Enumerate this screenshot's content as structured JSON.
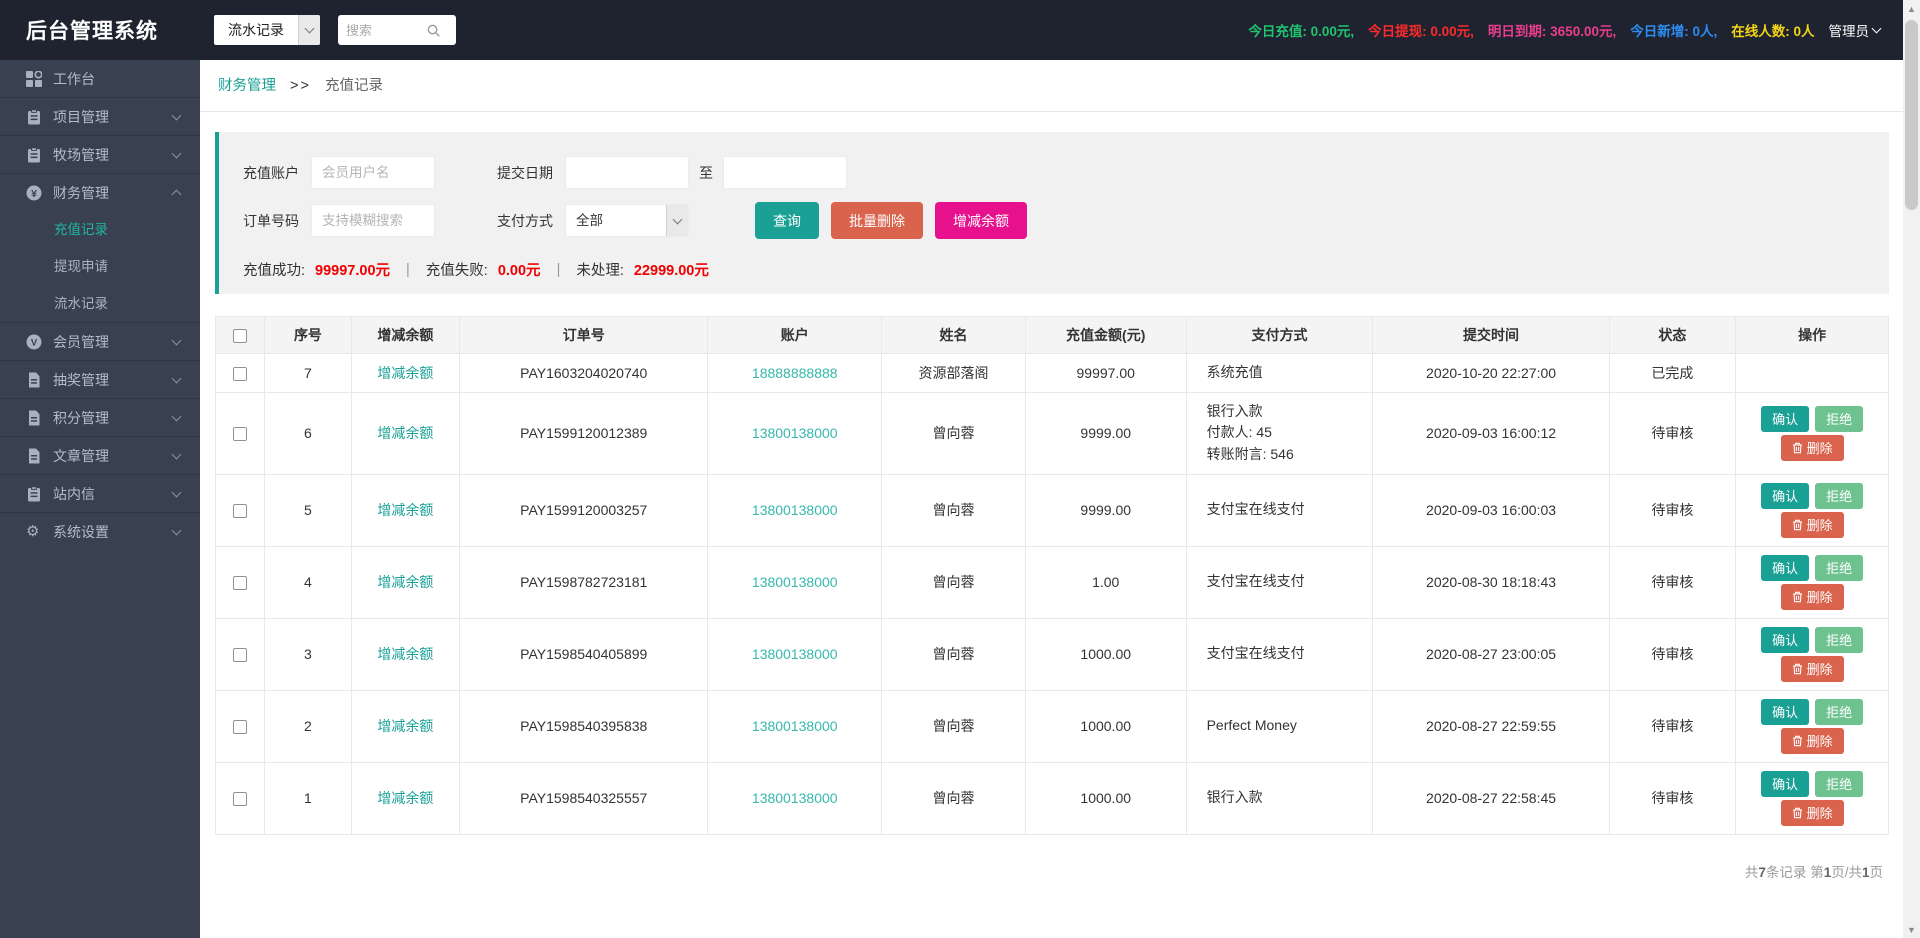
{
  "colors": {
    "accent_teal": "#1aa094",
    "danger_red": "#d9634c",
    "magenta": "#e8118d",
    "reject_green": "#6ec28f",
    "summary_red": "#f00000",
    "account_teal": "#36b8ad"
  },
  "header": {
    "title": "后台管理系统",
    "module_select_value": "流水记录",
    "search_placeholder": "搜索",
    "stats": [
      {
        "label": "今日充值:",
        "value": "0.00元,",
        "color": "#21c46e"
      },
      {
        "label": "今日提现:",
        "value": "0.00元,",
        "color": "#fb2b2b"
      },
      {
        "label": "明日到期:",
        "value": "3650.00元,",
        "color": "#e83e8c"
      },
      {
        "label": "今日新增:",
        "value": "0人,",
        "color": "#2d8cf0"
      },
      {
        "label": "在线人数:",
        "value": "0人",
        "color": "#f5d515"
      }
    ],
    "admin_label": "管理员"
  },
  "sidebar": {
    "items": [
      {
        "id": "workbench",
        "label": "工作台",
        "icon": "dashboard-icon",
        "expandable": false
      },
      {
        "id": "project",
        "label": "项目管理",
        "icon": "clipboard-icon",
        "expandable": true
      },
      {
        "id": "pasture",
        "label": "牧场管理",
        "icon": "clipboard-icon",
        "expandable": true
      },
      {
        "id": "finance",
        "label": "财务管理",
        "icon": "yen-circle-icon",
        "expandable": true,
        "expanded": true,
        "children": [
          {
            "id": "recharge-records",
            "label": "充值记录",
            "active": true
          },
          {
            "id": "withdraw-apply",
            "label": "提现申请",
            "active": false
          },
          {
            "id": "flow-records",
            "label": "流水记录",
            "active": false
          }
        ]
      },
      {
        "id": "member",
        "label": "会员管理",
        "icon": "v-circle-icon",
        "expandable": true
      },
      {
        "id": "lottery",
        "label": "抽奖管理",
        "icon": "document-icon",
        "expandable": true
      },
      {
        "id": "points",
        "label": "积分管理",
        "icon": "document-icon",
        "expandable": true
      },
      {
        "id": "article",
        "label": "文章管理",
        "icon": "document-icon",
        "expandable": true
      },
      {
        "id": "site-message",
        "label": "站内信",
        "icon": "clipboard-icon",
        "expandable": true
      },
      {
        "id": "system-settings",
        "label": "系统设置",
        "icon": "gear-icon",
        "expandable": true
      }
    ]
  },
  "breadcrumb": {
    "parent": "财务管理",
    "separator": ">>",
    "current": "充值记录"
  },
  "filters": {
    "recharge_account_label": "充值账户",
    "recharge_account_placeholder": "会员用户名",
    "submit_date_label": "提交日期",
    "date_to_label": "至",
    "order_no_label": "订单号码",
    "order_no_placeholder": "支持模糊搜索",
    "pay_method_label": "支付方式",
    "pay_method_value": "全部",
    "buttons": {
      "query": "查询",
      "batch_delete": "批量删除",
      "adjust_balance": "增减余额"
    },
    "summary_separator": "|",
    "summary": [
      {
        "label": "充值成功:",
        "value": "99997.00元"
      },
      {
        "label": "充值失败:",
        "value": "0.00元"
      },
      {
        "label": "未处理:",
        "value": "22999.00元"
      }
    ]
  },
  "table": {
    "headers": [
      "序号",
      "增减余额",
      "订单号",
      "账户",
      "姓名",
      "充值金额(元)",
      "支付方式",
      "提交时间",
      "状态",
      "操作"
    ],
    "adjust_link_label": "增减余额",
    "action_labels": {
      "confirm": "确认",
      "reject": "拒绝",
      "delete": "删除"
    },
    "rows": [
      {
        "seq": "7",
        "order_no": "PAY1603204020740",
        "account": "18888888888",
        "name": "资源部落阁",
        "amount": "99997.00",
        "pay_method": [
          "系统充值"
        ],
        "time": "2020-10-20 22:27:00",
        "status": "已完成",
        "actions": false
      },
      {
        "seq": "6",
        "order_no": "PAY1599120012389",
        "account": "13800138000",
        "name": "曾向蓉",
        "amount": "9999.00",
        "pay_method": [
          "银行入款",
          "付款人: 45",
          "转账附言: 546"
        ],
        "time": "2020-09-03 16:00:12",
        "status": "待审核",
        "actions": true
      },
      {
        "seq": "5",
        "order_no": "PAY1599120003257",
        "account": "13800138000",
        "name": "曾向蓉",
        "amount": "9999.00",
        "pay_method": [
          "支付宝在线支付"
        ],
        "time": "2020-09-03 16:00:03",
        "status": "待审核",
        "actions": true
      },
      {
        "seq": "4",
        "order_no": "PAY1598782723181",
        "account": "13800138000",
        "name": "曾向蓉",
        "amount": "1.00",
        "pay_method": [
          "支付宝在线支付"
        ],
        "time": "2020-08-30 18:18:43",
        "status": "待审核",
        "actions": true
      },
      {
        "seq": "3",
        "order_no": "PAY1598540405899",
        "account": "13800138000",
        "name": "曾向蓉",
        "amount": "1000.00",
        "pay_method": [
          "支付宝在线支付"
        ],
        "time": "2020-08-27 23:00:05",
        "status": "待审核",
        "actions": true
      },
      {
        "seq": "2",
        "order_no": "PAY1598540395838",
        "account": "13800138000",
        "name": "曾向蓉",
        "amount": "1000.00",
        "pay_method": [
          "Perfect Money"
        ],
        "time": "2020-08-27 22:59:55",
        "status": "待审核",
        "actions": true
      },
      {
        "seq": "1",
        "order_no": "PAY1598540325557",
        "account": "13800138000",
        "name": "曾向蓉",
        "amount": "1000.00",
        "pay_method": [
          "银行入款"
        ],
        "time": "2020-08-27 22:58:45",
        "status": "待审核",
        "actions": true
      }
    ]
  },
  "footer": {
    "parts": [
      {
        "text": "共",
        "bold": false
      },
      {
        "text": "7",
        "bold": true
      },
      {
        "text": "条记录 第",
        "bold": false
      },
      {
        "text": "1",
        "bold": true
      },
      {
        "text": "页/共",
        "bold": false
      },
      {
        "text": "1",
        "bold": true
      },
      {
        "text": "页",
        "bold": false
      }
    ]
  }
}
